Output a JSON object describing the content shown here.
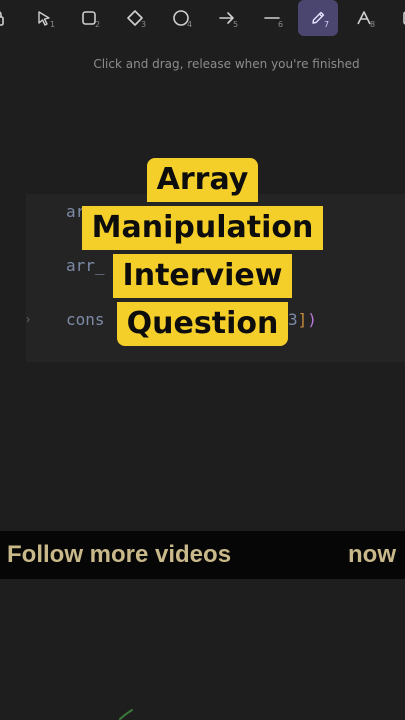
{
  "toolbar": {
    "tools": [
      {
        "name": "lock-tool",
        "icon": "lock-icon",
        "number": ""
      },
      {
        "name": "select-tool",
        "icon": "pointer-icon",
        "number": "1"
      },
      {
        "name": "rectangle-tool",
        "icon": "rectangle-icon",
        "number": "2"
      },
      {
        "name": "diamond-tool",
        "icon": "diamond-icon",
        "number": "3"
      },
      {
        "name": "ellipse-tool",
        "icon": "circle-icon",
        "number": "4"
      },
      {
        "name": "arrow-tool",
        "icon": "arrow-icon",
        "number": "5"
      },
      {
        "name": "line-tool",
        "icon": "line-icon",
        "number": "6"
      },
      {
        "name": "pencil-tool",
        "icon": "pencil-icon",
        "number": "7",
        "active": true
      },
      {
        "name": "text-tool",
        "icon": "text-icon",
        "number": "8"
      },
      {
        "name": "image-tool",
        "icon": "image-icon",
        "number": ""
      }
    ],
    "active_color": "#4a4670"
  },
  "hint": "Click and drag, release when you're finished",
  "code": {
    "line1": "arr_num",
    "line2": "arr_",
    "line3_start": "cons",
    "line3_end": "3",
    "bracket1": "]",
    "bracket2": ")",
    "gutter": "›"
  },
  "title": {
    "lines": [
      "Array",
      "Manipulation",
      "Interview",
      "Question"
    ],
    "background": "#f5cf29"
  },
  "banner": {
    "left": "Follow more videos",
    "right": "now",
    "text_color": "#c9b98a"
  }
}
